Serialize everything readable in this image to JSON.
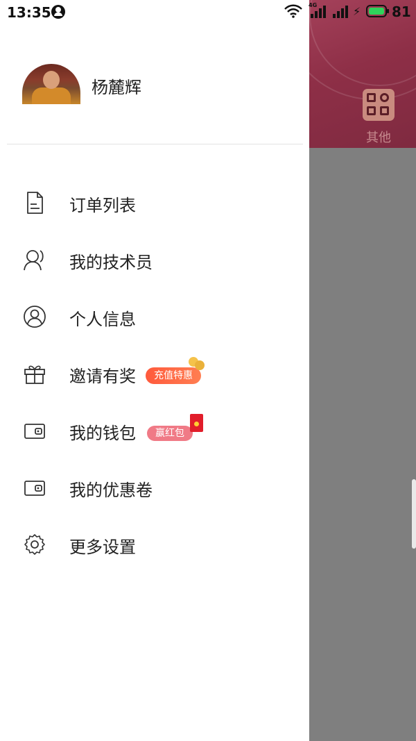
{
  "status_bar": {
    "time": "13:35",
    "network": "4G",
    "battery": "81",
    "battery_level_percent": 81
  },
  "profile": {
    "name": "杨麓辉"
  },
  "menu": [
    {
      "label": "订单列表",
      "icon": "document-icon"
    },
    {
      "label": "我的技术员",
      "icon": "technician-icon"
    },
    {
      "label": "个人信息",
      "icon": "user-circle-icon"
    },
    {
      "label": "邀请有奖",
      "icon": "gift-icon",
      "badge": "充值特惠"
    },
    {
      "label": "我的钱包",
      "icon": "wallet-icon",
      "badge": "赢红包"
    },
    {
      "label": "我的优惠卷",
      "icon": "coupon-wallet-icon"
    },
    {
      "label": "更多设置",
      "icon": "gear-icon"
    }
  ],
  "background_screen": {
    "other_label": "其他"
  },
  "colors": {
    "header_bg": "#8e2f47",
    "badge_orange": "#ff5a3c",
    "badge_pink": "#f07a86",
    "overlay": "#7f7f7f"
  }
}
